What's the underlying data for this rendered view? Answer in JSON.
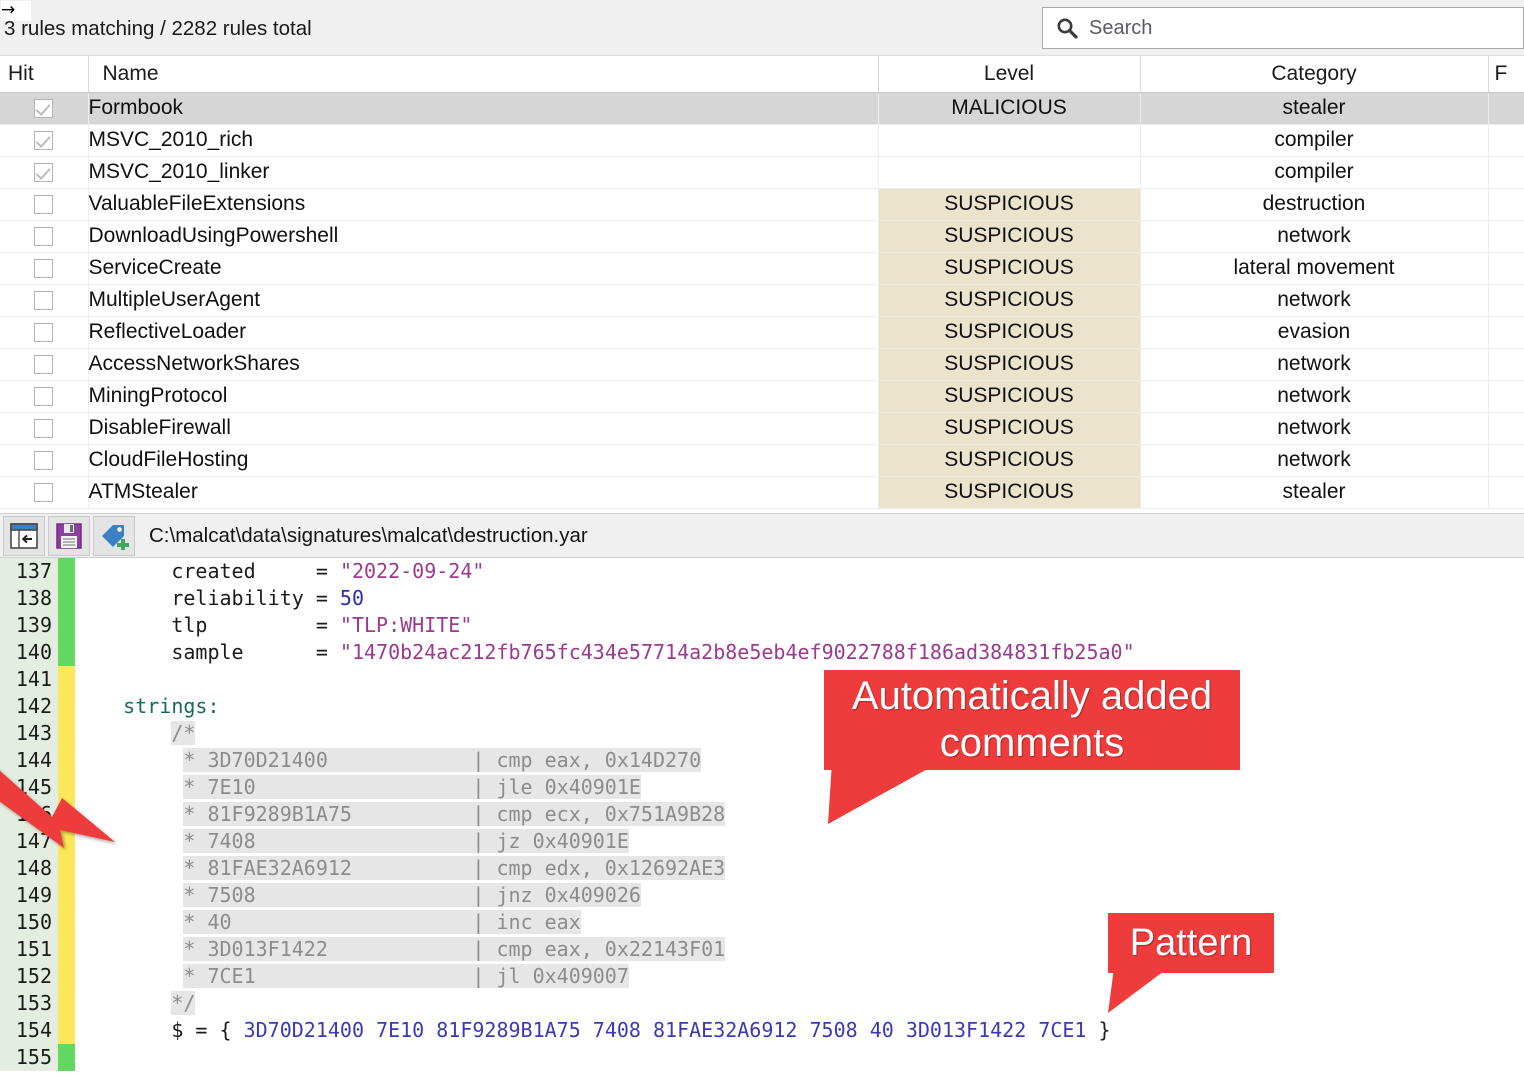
{
  "topbar": {
    "back_arrow_icon": "right-arrow-icon",
    "rules_status": "3 rules matching / 2282 rules total",
    "search": {
      "icon": "search-icon",
      "placeholder": "Search",
      "value": ""
    }
  },
  "table": {
    "columns": [
      {
        "key": "hit",
        "label": "Hit"
      },
      {
        "key": "name",
        "label": "Name"
      },
      {
        "key": "level",
        "label": "Level"
      },
      {
        "key": "cat",
        "label": "Category"
      },
      {
        "key": "extra",
        "label": "F"
      }
    ],
    "rows": [
      {
        "hit": true,
        "name": "Formbook",
        "level": "MALICIOUS",
        "category": "stealer"
      },
      {
        "hit": true,
        "name": "MSVC_2010_rich",
        "level": "",
        "category": "compiler"
      },
      {
        "hit": true,
        "name": "MSVC_2010_linker",
        "level": "",
        "category": "compiler"
      },
      {
        "hit": false,
        "name": "ValuableFileExtensions",
        "level": "SUSPICIOUS",
        "category": "destruction"
      },
      {
        "hit": false,
        "name": "DownloadUsingPowershell",
        "level": "SUSPICIOUS",
        "category": "network"
      },
      {
        "hit": false,
        "name": "ServiceCreate",
        "level": "SUSPICIOUS",
        "category": "lateral movement"
      },
      {
        "hit": false,
        "name": "MultipleUserAgent",
        "level": "SUSPICIOUS",
        "category": "network"
      },
      {
        "hit": false,
        "name": "ReflectiveLoader",
        "level": "SUSPICIOUS",
        "category": "evasion"
      },
      {
        "hit": false,
        "name": "AccessNetworkShares",
        "level": "SUSPICIOUS",
        "category": "network"
      },
      {
        "hit": false,
        "name": "MiningProtocol",
        "level": "SUSPICIOUS",
        "category": "network"
      },
      {
        "hit": false,
        "name": "DisableFirewall",
        "level": "SUSPICIOUS",
        "category": "network"
      },
      {
        "hit": false,
        "name": "CloudFileHosting",
        "level": "SUSPICIOUS",
        "category": "network"
      },
      {
        "hit": false,
        "name": "ATMStealer",
        "level": "SUSPICIOUS",
        "category": "stealer"
      }
    ],
    "selected_row_index": 0,
    "colors": {
      "malicious": "#b94a48",
      "suspicious_text": "#8a7b2a",
      "suspicious_bg": "#ece3cc",
      "selected_bg": "#d6d6d6"
    }
  },
  "editor_toolbar": {
    "buttons": [
      {
        "name": "goto-back-button",
        "icon": "window-back-arrow-icon"
      },
      {
        "name": "save-button",
        "icon": "floppy-save-icon"
      },
      {
        "name": "add-tag-button",
        "icon": "tag-plus-icon"
      }
    ],
    "file_path": "C:\\malcat\\data\\signatures\\malcat\\destruction.yar"
  },
  "code": {
    "lines": [
      {
        "num": "137",
        "mark": "green",
        "text": "        created     = \"2022-09-24\""
      },
      {
        "num": "138",
        "mark": "green",
        "text": "        reliability = 50"
      },
      {
        "num": "139",
        "mark": "green",
        "text": "        tlp         = \"TLP:WHITE\""
      },
      {
        "num": "140",
        "mark": "green",
        "text": "        sample      = \"1470b24ac212fb765fc434e57714a2b8e5eb4ef9022788f186ad384831fb25a0\""
      },
      {
        "num": "141",
        "mark": "yellow",
        "text": ""
      },
      {
        "num": "142",
        "mark": "yellow",
        "text": "    strings:"
      },
      {
        "num": "143",
        "mark": "yellow",
        "text": "        /*"
      },
      {
        "num": "144",
        "mark": "yellow",
        "text": "         * 3D70D21400            | cmp eax, 0x14D270"
      },
      {
        "num": "145",
        "mark": "yellow",
        "text": "         * 7E10                  | jle 0x40901E"
      },
      {
        "num": "146",
        "mark": "yellow",
        "text": "         * 81F9289B1A75          | cmp ecx, 0x751A9B28"
      },
      {
        "num": "147",
        "mark": "yellow",
        "text": "         * 7408                  | jz 0x40901E"
      },
      {
        "num": "148",
        "mark": "yellow",
        "text": "         * 81FAE32A6912          | cmp edx, 0x12692AE3"
      },
      {
        "num": "149",
        "mark": "yellow",
        "text": "         * 7508                  | jnz 0x409026"
      },
      {
        "num": "150",
        "mark": "yellow",
        "text": "         * 40                    | inc eax"
      },
      {
        "num": "151",
        "mark": "yellow",
        "text": "         * 3D013F1422            | cmp eax, 0x22143F01"
      },
      {
        "num": "152",
        "mark": "yellow",
        "text": "         * 7CE1                  | jl 0x409007"
      },
      {
        "num": "153",
        "mark": "yellow",
        "text": "        */"
      },
      {
        "num": "154",
        "mark": "yellow",
        "text": "        $ = { 3D70D21400 7E10 81F9289B1A75 7408 81FAE32A6912 7508 40 3D013F1422 7CE1 }"
      },
      {
        "num": "155",
        "mark": "green",
        "text": ""
      }
    ]
  },
  "annotations": {
    "callout_comments": "Automatically added comments",
    "callout_pattern": "Pattern",
    "arrow_left": "red-arrow-icon",
    "color": "#ee3b3b"
  }
}
